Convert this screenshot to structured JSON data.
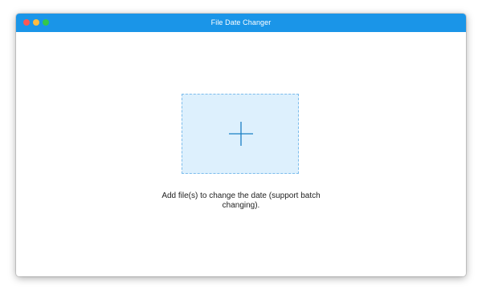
{
  "window": {
    "title": "File Date Changer",
    "titlebar_color": "#1a95e8",
    "controls": {
      "close_color": "#fc5753",
      "minimize_color": "#fdbc40",
      "maximize_color": "#34c84a"
    }
  },
  "main": {
    "dropzone": {
      "icon": "plus-icon",
      "background_color": "#ddf0fd",
      "border_color": "#7cbcec"
    },
    "hint_text": "Add file(s) to change the date (support batch changing)."
  }
}
